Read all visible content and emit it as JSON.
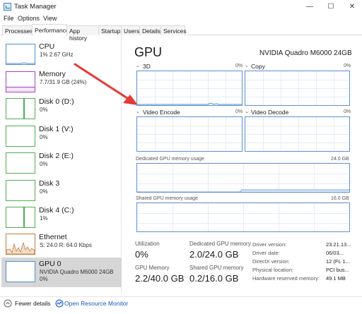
{
  "window": {
    "title": "Task Manager",
    "minimize": "—",
    "maximize": "☐",
    "close": "✕"
  },
  "menu": [
    "File",
    "Options",
    "View"
  ],
  "tabs": [
    "Processes",
    "Performance",
    "App history",
    "Startup",
    "Users",
    "Details",
    "Services"
  ],
  "active_tab": "Performance",
  "resources": [
    {
      "name": "CPU",
      "sub1": "1% 2.67 GHz",
      "sub2": ""
    },
    {
      "name": "Memory",
      "sub1": "7.7/31.9 GB (24%)",
      "sub2": ""
    },
    {
      "name": "Disk 0 (D:)",
      "sub1": "0%",
      "sub2": ""
    },
    {
      "name": "Disk 1 (V:)",
      "sub1": "0%",
      "sub2": ""
    },
    {
      "name": "Disk 2 (E:)",
      "sub1": "0%",
      "sub2": ""
    },
    {
      "name": "Disk 3",
      "sub1": "0%",
      "sub2": ""
    },
    {
      "name": "Disk 4 (C:)",
      "sub1": "1%",
      "sub2": ""
    },
    {
      "name": "Ethernet",
      "sub1": "S: 24.0 R: 64.0 Kbps",
      "sub2": ""
    },
    {
      "name": "GPU 0",
      "sub1": "NVIDIA Quadro M6000 24GB",
      "sub2": "0%"
    }
  ],
  "colors": {
    "cpu": "#4b8fd6",
    "memory": "#a444c0",
    "disk": "#4caf50",
    "ethernet": "#c27a3f",
    "gpu": "#4b8fd6",
    "arrow": "#e53935"
  },
  "gpu": {
    "title": "GPU",
    "model": "NVIDIA Quadro M6000 24GB",
    "engines": [
      {
        "label": "3D",
        "pct": "0%"
      },
      {
        "label": "Copy",
        "pct": "0%"
      },
      {
        "label": "Video Encode",
        "pct": "0%"
      },
      {
        "label": "Video Decode",
        "pct": "0%"
      }
    ],
    "dedicated_label": "Dedicated GPU memory usage",
    "dedicated_max": "24.0 GB",
    "shared_label": "Shared GPU memory usage",
    "shared_max": "16.0 GB",
    "stats": {
      "utilization_label": "Utilization",
      "utilization_value": "0%",
      "dedicated_label": "Dedicated GPU memory",
      "dedicated_value": "2.0/24.0 GB",
      "gpu_memory_label": "GPU Memory",
      "gpu_memory_value": "2.2/40.0 GB",
      "shared_label": "Shared GPU memory",
      "shared_value": "0.2/16.0 GB"
    },
    "props": [
      {
        "label": "Driver version:",
        "value": "23.21.13..."
      },
      {
        "label": "Driver date:",
        "value": "06/03..."
      },
      {
        "label": "DirectX version:",
        "value": "12 (FL 1..."
      },
      {
        "label": "Physical location:",
        "value": "PCI bus..."
      },
      {
        "label": "Hardware reserved memory:",
        "value": "49.1 MB"
      }
    ]
  },
  "footer": {
    "fewer_details": "Fewer details",
    "open_monitor": "Open Resource Monitor"
  }
}
